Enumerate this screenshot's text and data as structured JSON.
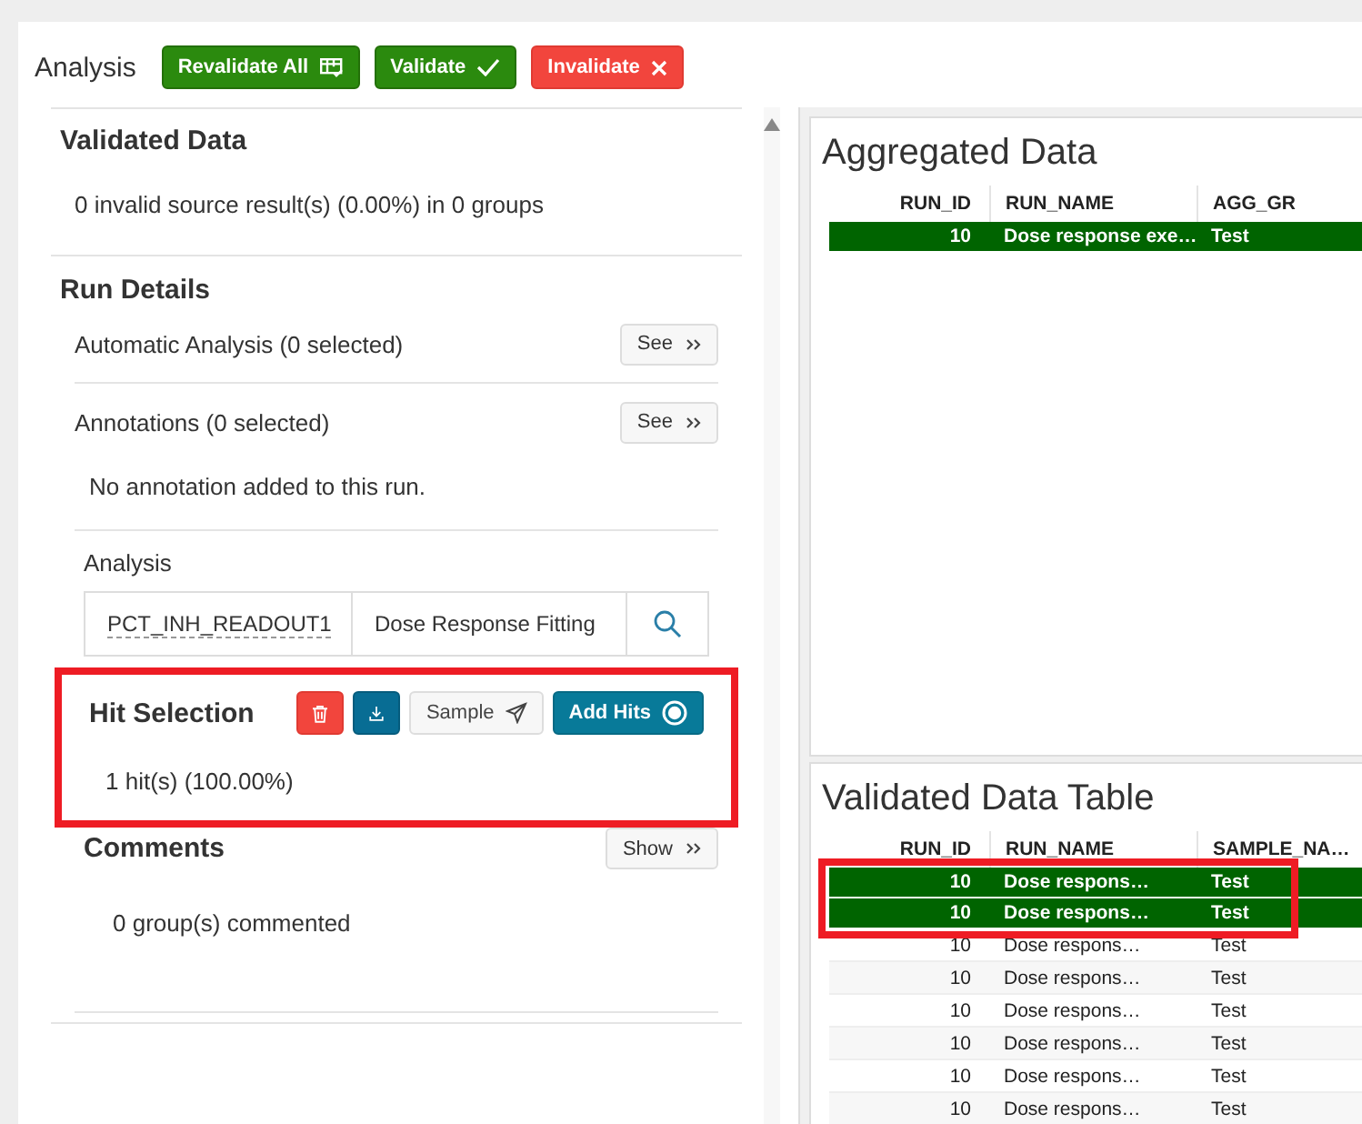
{
  "header": {
    "title": "Analysis",
    "buttons": [
      {
        "label": "Revalidate All",
        "kind": "revalidate"
      },
      {
        "label": "Validate",
        "kind": "validate"
      },
      {
        "label": "Invalidate",
        "kind": "invalidate"
      }
    ]
  },
  "validated_data": {
    "title": "Validated Data",
    "summary": "0 invalid source result(s) (0.00%) in 0 groups"
  },
  "run_details": {
    "title": "Run Details",
    "automatic_analysis": {
      "label": "Automatic Analysis (0 selected)",
      "button": "See"
    },
    "annotations": {
      "label": "Annotations (0 selected)",
      "button": "See",
      "note": "No annotation added to this run."
    },
    "analysis": {
      "label": "Analysis",
      "readout": "PCT_INH_READOUT1",
      "method": "Dose Response Fitting"
    }
  },
  "hit_selection": {
    "title": "Hit Selection",
    "highlighted": true,
    "summary": "1 hit(s) (100.00%)",
    "buttons": [
      {
        "kind": "delete"
      },
      {
        "kind": "download"
      },
      {
        "kind": "sample",
        "label": "Sample"
      },
      {
        "kind": "add_hits",
        "label": "Add Hits"
      }
    ]
  },
  "comments": {
    "title": "Comments",
    "button": "Show",
    "summary": "0 group(s) commented"
  },
  "aggregated_data": {
    "title": "Aggregated Data",
    "columns": [
      "RUN_ID",
      "RUN_NAME",
      "AGG_GR"
    ],
    "rows": [
      {
        "cells": [
          "10",
          "Dose response exe…",
          "Test"
        ],
        "selected": true
      }
    ]
  },
  "validated_data_table": {
    "title": "Validated Data Table",
    "columns": [
      "RUN_ID",
      "RUN_NAME",
      "SAMPLE_NA…"
    ],
    "highlighted": true,
    "rows": [
      {
        "cells": [
          "10",
          "Dose respons…",
          "Test"
        ],
        "selected": true
      },
      {
        "cells": [
          "10",
          "Dose respons…",
          "Test"
        ],
        "selected": true
      },
      {
        "cells": [
          "10",
          "Dose respons…",
          "Test"
        ],
        "selected": false
      },
      {
        "cells": [
          "10",
          "Dose respons…",
          "Test"
        ],
        "selected": false
      },
      {
        "cells": [
          "10",
          "Dose respons…",
          "Test"
        ],
        "selected": false
      },
      {
        "cells": [
          "10",
          "Dose respons…",
          "Test"
        ],
        "selected": false
      },
      {
        "cells": [
          "10",
          "Dose respons…",
          "Test"
        ],
        "selected": false
      },
      {
        "cells": [
          "10",
          "Dose respons…",
          "Test"
        ],
        "selected": false
      }
    ]
  }
}
